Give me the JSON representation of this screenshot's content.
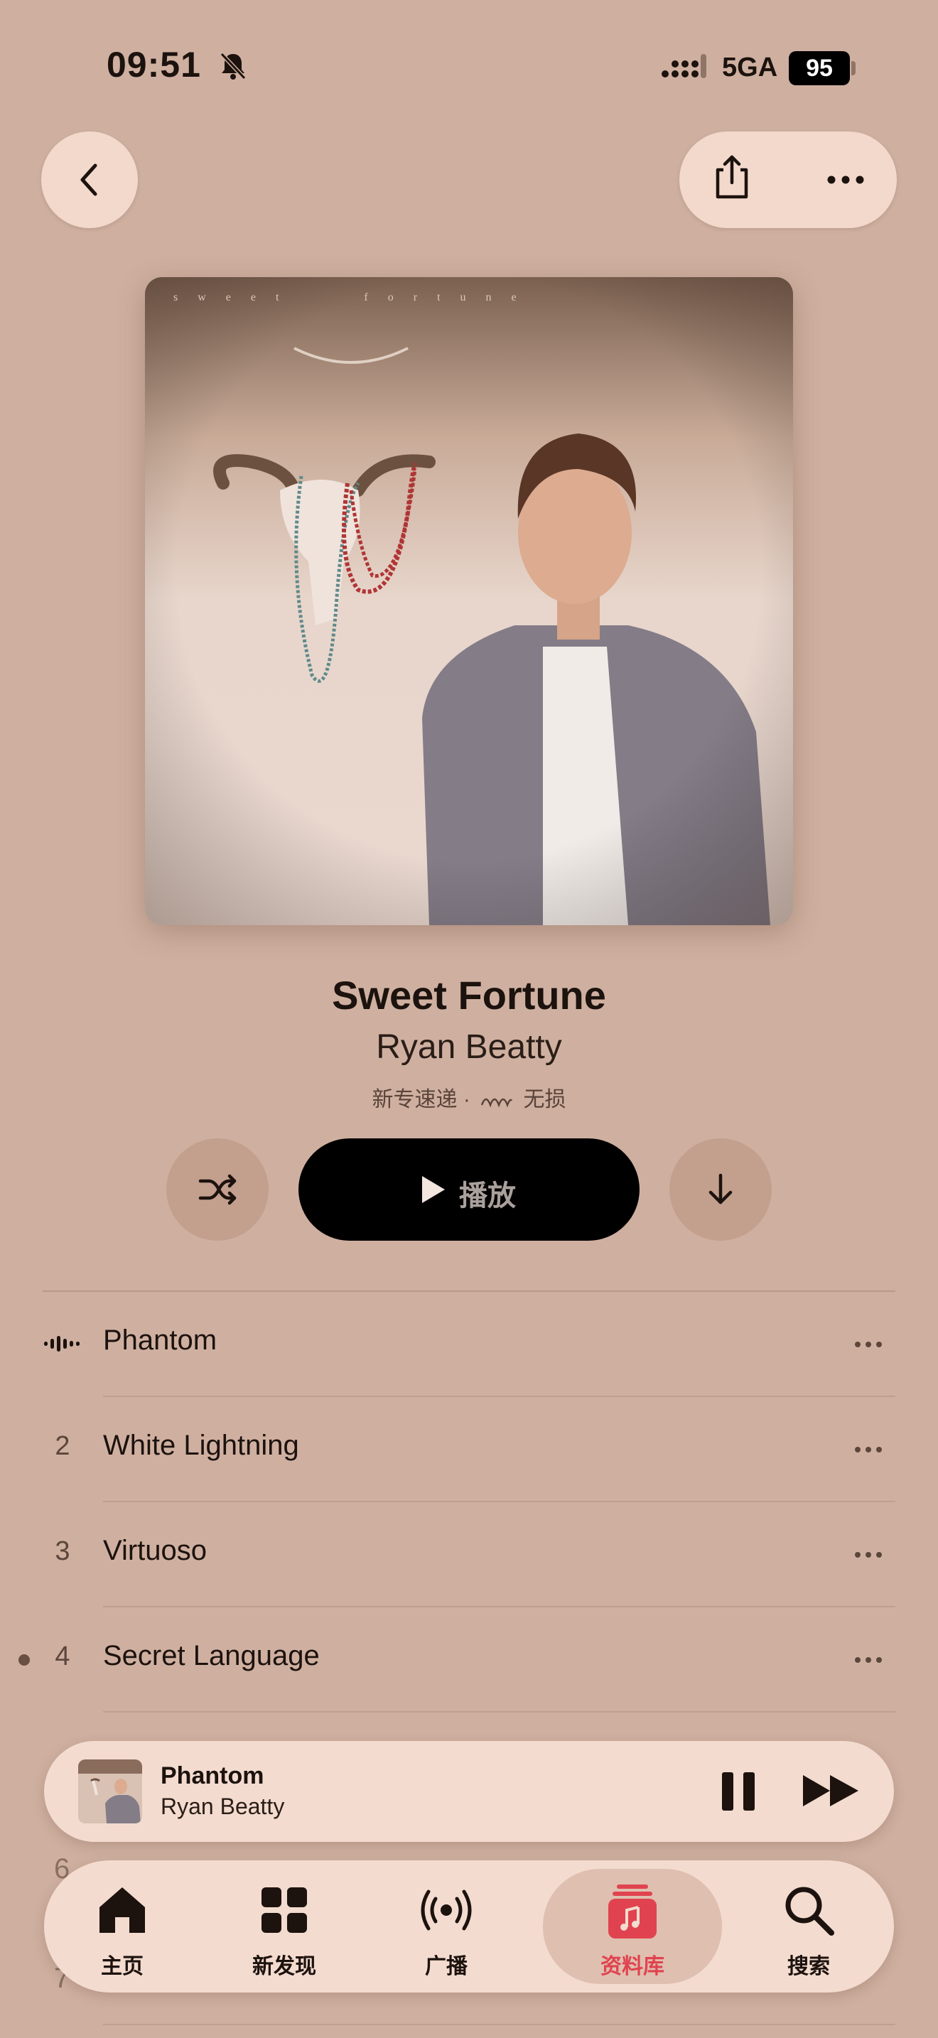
{
  "status_bar": {
    "time": "09:51",
    "network": "5GA",
    "battery": "95"
  },
  "nav": {
    "back_icon": "chevron-left-icon",
    "share_icon": "share-icon",
    "more_icon": "ellipsis-icon"
  },
  "album": {
    "artwork_caption": "sweet fortune",
    "title": "Sweet Fortune",
    "artist": "Ryan Beatty",
    "meta_prefix": "新专速递 ·",
    "meta_suffix": "无损"
  },
  "controls": {
    "play_label": "播放"
  },
  "tracks": [
    {
      "num": "",
      "title": "Phantom",
      "playing": true
    },
    {
      "num": "2",
      "title": "White Lightning"
    },
    {
      "num": "3",
      "title": "Virtuoso"
    },
    {
      "num": "4",
      "title": "Secret Language",
      "dot": true
    }
  ],
  "ghost_rows": {
    "row6_num": "6",
    "row7_num": "7"
  },
  "mini_player": {
    "title": "Phantom",
    "artist": "Ryan Beatty"
  },
  "tab_bar": {
    "tabs": [
      {
        "label": "主页",
        "icon": "home-icon"
      },
      {
        "label": "新发现",
        "icon": "grid-icon"
      },
      {
        "label": "广播",
        "icon": "radio-icon"
      },
      {
        "label": "资料库",
        "icon": "library-icon",
        "active": true
      },
      {
        "label": "搜索",
        "icon": "search-icon"
      }
    ]
  },
  "colors": {
    "background": "#cfb0a0",
    "accent": "#e0434f"
  }
}
